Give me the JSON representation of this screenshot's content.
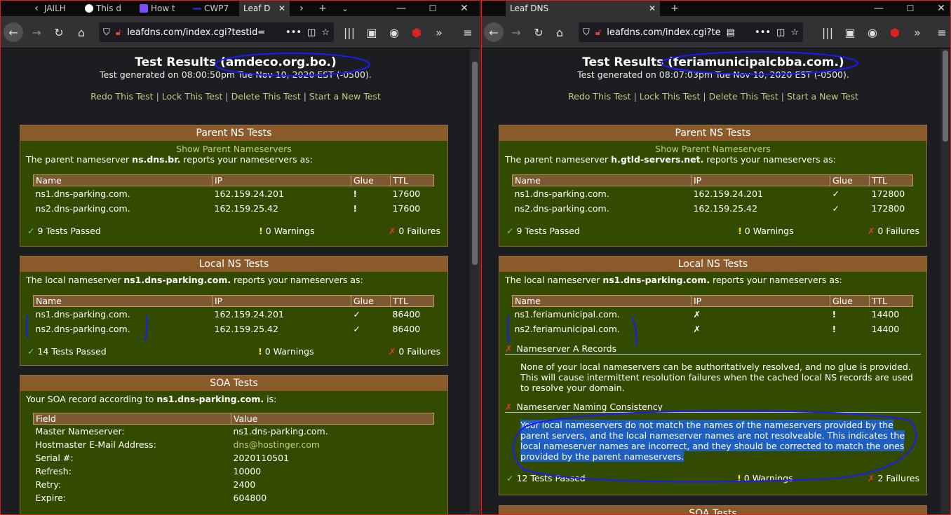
{
  "left": {
    "tabs": [
      "JAILH",
      "This d",
      "How t",
      "CWP7",
      "Leaf D"
    ],
    "url": "leafdns.com/index.cgi?testid=",
    "title": "Test Results (amdeco.org.bo.)",
    "generated": "Test generated on 08:00:50pm Tue Nov 10, 2020 EST (-0500).",
    "links": [
      "Redo This Test",
      "Lock This Test",
      "Delete This Test",
      "Start a New Test"
    ],
    "parent": {
      "title": "Parent NS Tests",
      "show": "Show Parent Nameservers",
      "intro_pre": "The parent nameserver ",
      "intro_ns": "ns.dns.br.",
      "intro_post": " reports your nameservers as:",
      "headers": [
        "Name",
        "IP",
        "Glue",
        "TTL"
      ],
      "rows": [
        {
          "name": "ns1.dns-parking.com.",
          "ip": "162.159.24.201",
          "glue": "warn",
          "ttl": "17600"
        },
        {
          "name": "ns2.dns-parking.com.",
          "ip": "162.159.25.42",
          "glue": "warn",
          "ttl": "17600"
        }
      ],
      "passed": "9 Tests Passed",
      "warnings": "0 Warnings",
      "failures": "0 Failures"
    },
    "local": {
      "title": "Local NS Tests",
      "intro_pre": "The local nameserver ",
      "intro_ns": "ns1.dns-parking.com.",
      "intro_post": " reports your nameservers as:",
      "headers": [
        "Name",
        "IP",
        "Glue",
        "TTL"
      ],
      "rows": [
        {
          "name": "ns1.dns-parking.com.",
          "ip": "162.159.24.201",
          "glue": "ok",
          "ttl": "86400"
        },
        {
          "name": "ns2.dns-parking.com.",
          "ip": "162.159.25.42",
          "glue": "ok",
          "ttl": "86400"
        }
      ],
      "passed": "14 Tests Passed",
      "warnings": "0 Warnings",
      "failures": "0 Failures"
    },
    "soa": {
      "title": "SOA Tests",
      "intro_pre": "Your SOA record according to ",
      "intro_ns": "ns1.dns-parking.com.",
      "intro_post": " is:",
      "headers": [
        "Field",
        "Value"
      ],
      "rows": [
        {
          "field": "Master Nameserver:",
          "value": "ns1.dns-parking.com."
        },
        {
          "field": "Hostmaster E-Mail Address:",
          "value": "dns@hostinger.com"
        },
        {
          "field": "Serial #:",
          "value": "2020110501"
        },
        {
          "field": "Refresh:",
          "value": "10000"
        },
        {
          "field": "Retry:",
          "value": "2400"
        },
        {
          "field": "Expire:",
          "value": "604800"
        }
      ]
    }
  },
  "right": {
    "tabs": [
      "Leaf DNS"
    ],
    "url": "leafdns.com/index.cgi?te",
    "title": "Test Results (feriamunicipalcbba.com.)",
    "generated": "Test generated on 08:07:03pm Tue Nov 10, 2020 EST (-0500).",
    "links": [
      "Redo This Test",
      "Lock This Test",
      "Delete This Test",
      "Start a New Test"
    ],
    "parent": {
      "title": "Parent NS Tests",
      "show": "Show Parent Nameservers",
      "intro_pre": "The parent nameserver ",
      "intro_ns": "h.gtld-servers.net.",
      "intro_post": " reports your nameservers as:",
      "headers": [
        "Name",
        "IP",
        "Glue",
        "TTL"
      ],
      "rows": [
        {
          "name": "ns1.dns-parking.com.",
          "ip": "162.159.24.201",
          "glue": "ok",
          "ttl": "172800"
        },
        {
          "name": "ns2.dns-parking.com.",
          "ip": "162.159.25.42",
          "glue": "ok",
          "ttl": "172800"
        }
      ],
      "passed": "9 Tests Passed",
      "warnings": "0 Warnings",
      "failures": "0 Failures"
    },
    "local": {
      "title": "Local NS Tests",
      "intro_pre": "The local nameserver ",
      "intro_ns": "ns1.dns-parking.com.",
      "intro_post": " reports your nameservers as:",
      "headers": [
        "Name",
        "IP",
        "Glue",
        "TTL"
      ],
      "rows": [
        {
          "name": "ns1.feriamunicipal.com.",
          "ip": "fail",
          "glue": "warn",
          "ttl": "14400"
        },
        {
          "name": "ns2.feriamunicipal.com.",
          "ip": "fail",
          "glue": "warn",
          "ttl": "14400"
        }
      ],
      "sec1_title": "Nameserver A Records",
      "sec1_body": "None of your local nameservers can be authoritatively resolved, and no glue is provided. This will cause intermittent resolution failures when the cached local NS records are used to resolve your domain.",
      "sec2_title": "Nameserver Naming Consistency",
      "sec2_body": "Your local nameservers do not match the names of the nameservers provided by the parent servers, and the local nameserver names are not resolveable. This indicates the local nameserver names are incorrect, and they should be corrected to match the ones provided by the parent nameservers.",
      "passed": "12 Tests Passed",
      "warnings": "0 Warnings",
      "failures": "2 Failures"
    },
    "soa": {
      "title": "SOA Tests"
    }
  },
  "colors": {
    "panel_bg": "#334b00",
    "panel_title": "#8b5a2b",
    "link": "#c8c880",
    "ok": "#6ce24c",
    "warn": "#f6e63a",
    "fail": "#e03a3a",
    "ink": "#1a1aff"
  }
}
